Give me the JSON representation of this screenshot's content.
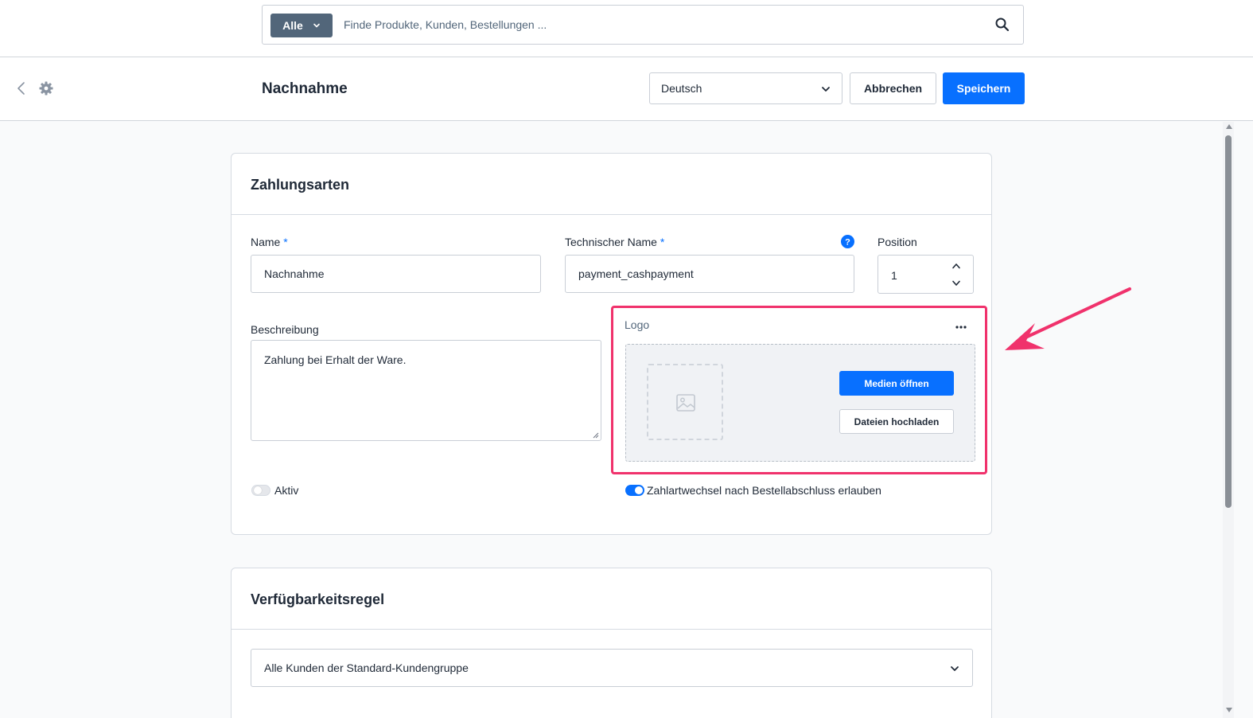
{
  "search": {
    "scope_label": "Alle",
    "placeholder": "Finde Produkte, Kunden, Bestellungen ..."
  },
  "header": {
    "title": "Nachnahme",
    "language": "Deutsch",
    "cancel_label": "Abbrechen",
    "save_label": "Speichern"
  },
  "payment_card": {
    "title": "Zahlungsarten",
    "name_label": "Name",
    "name_value": "Nachnahme",
    "technical_name_label": "Technischer Name",
    "technical_name_value": "payment_cashpayment",
    "required_mark": "*",
    "help_glyph": "?",
    "position_label": "Position",
    "position_value": "1",
    "description_label": "Beschreibung",
    "description_value": "Zahlung bei Erhalt der Ware.",
    "logo_label": "Logo",
    "open_media_label": "Medien öffnen",
    "upload_files_label": "Dateien hochladen",
    "active_label": "Aktiv",
    "active_on": false,
    "allow_change_label": "Zahlartwechsel nach Bestellabschluss erlauben",
    "allow_change_on": true
  },
  "availability_card": {
    "title": "Verfügbarkeitsregel",
    "rule_value": "Alle Kunden der Standard-Kundengruppe"
  },
  "colors": {
    "primary": "#0870ff",
    "highlight": "#f0326c",
    "scope_button": "#52667a"
  },
  "icons": [
    "search-icon",
    "chevron-down-icon",
    "back-icon",
    "gear-icon",
    "help-icon",
    "chevron-up-icon",
    "more-icon",
    "image-icon",
    "arrow-annotation"
  ]
}
